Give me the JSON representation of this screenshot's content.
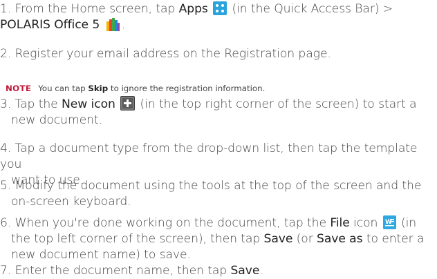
{
  "note": {
    "tag": "NOTE",
    "text_before": "You can tap ",
    "bold": "Skip",
    "text_after": " to ignore the registration information."
  },
  "steps": {
    "s1": {
      "a": "1. From the Home screen, tap ",
      "b1": "Apps",
      "c": " (in the Quick Access Bar) >",
      "b2": "POLARIS Office 5",
      "d": "."
    },
    "s2": {
      "text": "2. Register your email address on the Registration page."
    },
    "s3": {
      "a": "3. Tap the ",
      "b1": "New icon",
      "c": " (in the top right corner of the screen) to start a",
      "l2": "new document."
    },
    "s4": {
      "l1": "4. Tap a document type from the drop-down list, then tap the template you",
      "l2": "want to use."
    },
    "s5": {
      "l1": "5. Modify the document using the tools at the top of the screen and the",
      "l2": "on-screen keyboard."
    },
    "s6": {
      "a": "6. When you're done working on the document, tap the ",
      "b1": "File",
      "c": " icon ",
      "d": " (in",
      "l2a": "the top left corner of the screen), then tap ",
      "b2": "Save",
      "l2b": " (or ",
      "b3": "Save as",
      "l2c": " to enter a",
      "l3": "new document name) to save."
    },
    "s7": {
      "a": "7. Enter the document name, then tap ",
      "b1": "Save",
      "c": "."
    }
  },
  "icons": {
    "apps": "apps-grid-icon",
    "polaris": "polaris-office-icon",
    "new": "new-document-icon",
    "file": "file-icon"
  },
  "colors": {
    "note_tag": "#c01a3a",
    "apps_icon": "#2aa3dc",
    "file_icon": "#2fa7e0"
  }
}
